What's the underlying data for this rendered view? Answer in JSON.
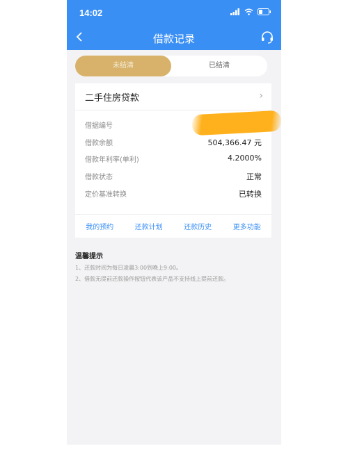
{
  "status_bar": {
    "time": "14:02"
  },
  "nav": {
    "title": "借款记录"
  },
  "tabs": [
    {
      "label": "未结清",
      "active": true
    },
    {
      "label": "已结清",
      "active": false
    }
  ],
  "loan": {
    "title": "二手住房贷款",
    "rows": [
      {
        "label": "借据编号",
        "value": ""
      },
      {
        "label": "借款余额",
        "value": "504,366.47 元"
      },
      {
        "label": "借款年利率(单利)",
        "value": "4.2000%"
      },
      {
        "label": "借款状态",
        "value": "正常"
      },
      {
        "label": "定价基准转换",
        "value": "已转换"
      }
    ],
    "actions": [
      "我的预约",
      "还款计划",
      "还款历史",
      "更多功能"
    ]
  },
  "tips": {
    "title": "温馨提示",
    "lines": [
      "1、还款时间为每日凌晨3:00到晚上9:00。",
      "2、借款无提前还款操作按钮代表该产品不支持线上提前还款。"
    ]
  },
  "colors": {
    "brand_blue": "#3a8ff5",
    "tab_gold": "#d8b26a",
    "redaction": "#ffb11d"
  }
}
